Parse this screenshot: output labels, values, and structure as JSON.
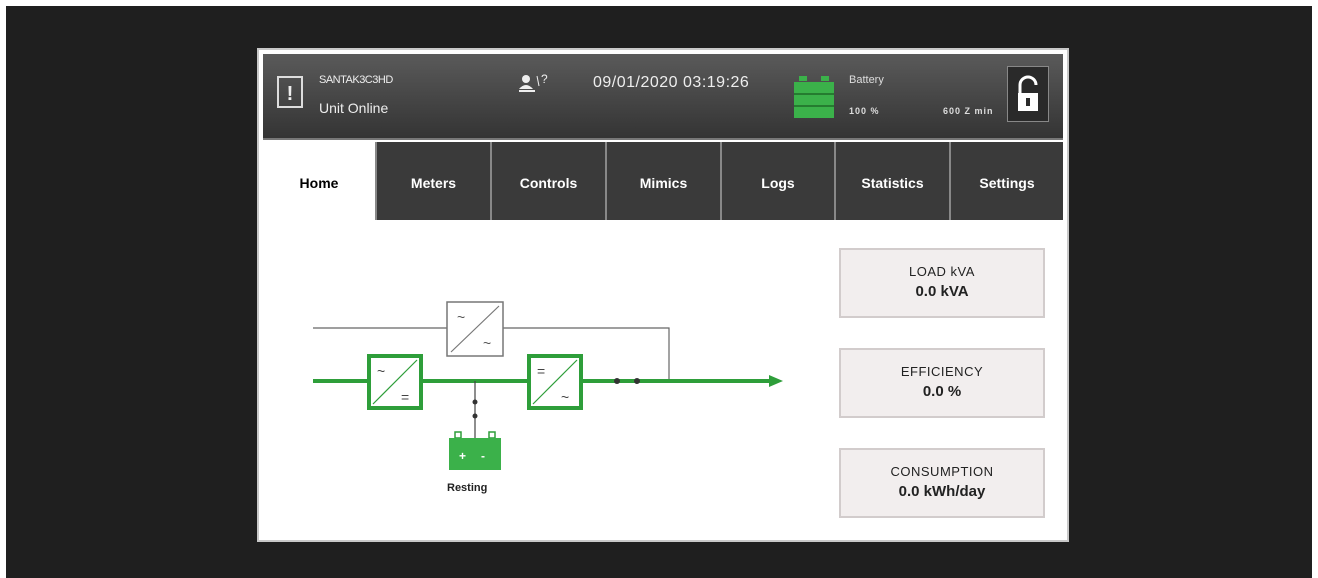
{
  "header": {
    "unit_name": "SANTAK3C3HD",
    "unit_status": "Unit Online",
    "datetime": "09/01/2020 03:19:26",
    "battery_label": "Battery",
    "battery_percent": "100 %",
    "battery_runtime": "600 Z min",
    "alarm_icon": "!"
  },
  "tabs": [
    {
      "label": "Home",
      "active": true
    },
    {
      "label": "Meters"
    },
    {
      "label": "Controls"
    },
    {
      "label": "Mimics"
    },
    {
      "label": "Logs"
    },
    {
      "label": "Statistics"
    },
    {
      "label": "Settings"
    }
  ],
  "diagram": {
    "battery_status": "Resting",
    "rectifier_top": "~",
    "rectifier_bottom": "=",
    "inverter_top": "=",
    "inverter_bottom": "~",
    "bypass_top": "~",
    "bypass_bottom": "~",
    "battery_plus": "+",
    "battery_minus": "-"
  },
  "metrics": {
    "load": {
      "label": "LOAD kVA",
      "value": "0.0 kVA"
    },
    "efficiency": {
      "label": "EFFICIENCY",
      "value": "0.0 %"
    },
    "consumption": {
      "label": "CONSUMPTION",
      "value": "0.0 kWh/day"
    }
  },
  "colors": {
    "accent_green": "#2e9e3a",
    "bar_dark": "#3a3a3a"
  }
}
